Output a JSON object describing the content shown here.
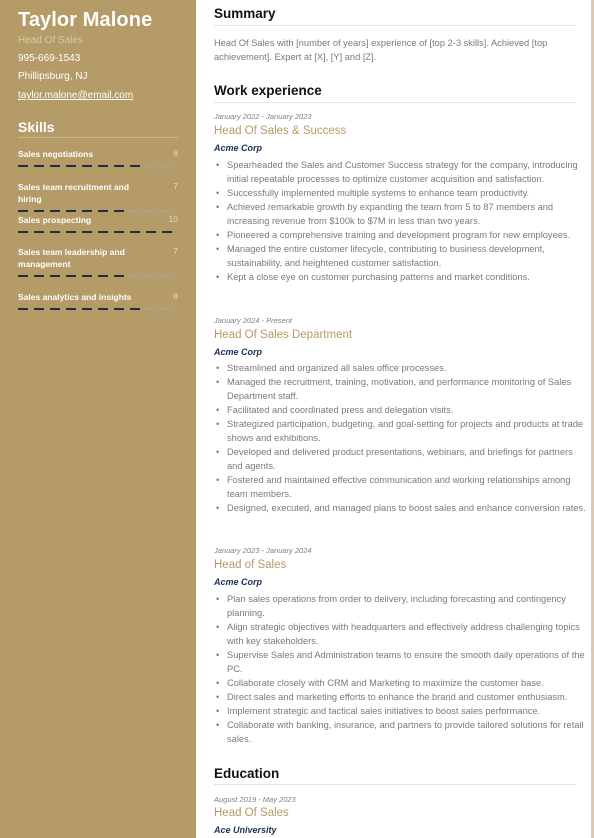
{
  "profile": {
    "name": "Taylor Malone",
    "role": "Head Of Sales",
    "phone": "995-669-1543",
    "location": "Phillipsburg, NJ",
    "email": "taylor.malone@email.com"
  },
  "skills": {
    "title": "Skills",
    "max": 10,
    "items": [
      {
        "name": "Sales negotiations",
        "level": "8",
        "value": 8
      },
      {
        "name": "Sales team recruitment and hiring",
        "level": "7",
        "value": 7
      },
      {
        "name": "Sales prospecting",
        "level": "10",
        "value": 10
      },
      {
        "name": "Sales team leadership and management",
        "level": "7",
        "value": 7
      },
      {
        "name": "Sales analytics and insights",
        "level": "8",
        "value": 8
      }
    ]
  },
  "summary": {
    "title": "Summary",
    "text": "Head Of Sales with [number of years] experience of [top 2-3 skills]. Achieved [top achievement]. Expert at [X], [Y] and [Z]."
  },
  "work": {
    "title": "Work experience",
    "jobs": [
      {
        "dates": "January 2022 - January 2023",
        "title": "Head Of Sales & Success",
        "company": "Acme Corp",
        "bullets": [
          "Spearheaded the Sales and Customer Success strategy for the company, introducing initial repeatable processes to optimize customer acquisition and satisfaction.",
          "Successfully implemented multiple systems to enhance team productivity.",
          "Achieved remarkable growth by expanding the team from 5 to 87 members and increasing revenue from $100k to $7M in less than two years.",
          "Pioneered a comprehensive training and development program for new employees.",
          "Managed the entire customer lifecycle, contributing to business development, sustainability, and heightened customer satisfaction.",
          "Kept a close eye on customer purchasing patterns and market conditions."
        ]
      },
      {
        "dates": "January 2024 - Present",
        "title": "Head Of Sales Department",
        "company": "Acme Corp",
        "bullets": [
          "Streamlined and organized all sales office processes.",
          "Managed the recruitment, training, motivation, and performance monitoring of Sales Department staff.",
          "Facilitated and coordinated press and delegation visits.",
          "Strategized participation, budgeting, and goal-setting for projects and products at trade shows and exhibitions.",
          "Developed and delivered product presentations, webinars, and briefings for partners and agents.",
          "Fostered and maintained effective communication and working relationships among team members.",
          "Designed, executed, and managed plans to boost sales and enhance conversion rates."
        ]
      },
      {
        "dates": "January 2023 - January 2024",
        "title": "Head of Sales",
        "company": "Acme Corp",
        "bullets": [
          "Plan sales operations from order to delivery, including forecasting and contingency planning.",
          "Align strategic objectives with headquarters and effectively address challenging topics with key stakeholders.",
          "Supervise Sales and Administration teams to ensure the smooth daily operations of the PC.",
          "Collaborate closely with CRM and Marketing to maximize the customer base.",
          "Direct sales and marketing efforts to enhance the brand and customer enthusiasm.",
          "Implement strategic and tactical sales initiatives to boost sales performance.",
          "Collaborate with banking, insurance, and partners to provide tailored solutions for retail sales."
        ]
      }
    ]
  },
  "education": {
    "title": "Education",
    "items": [
      {
        "dates": "August 2019 - May 2023",
        "title": "Head Of Sales",
        "school": "Ace University"
      }
    ]
  }
}
